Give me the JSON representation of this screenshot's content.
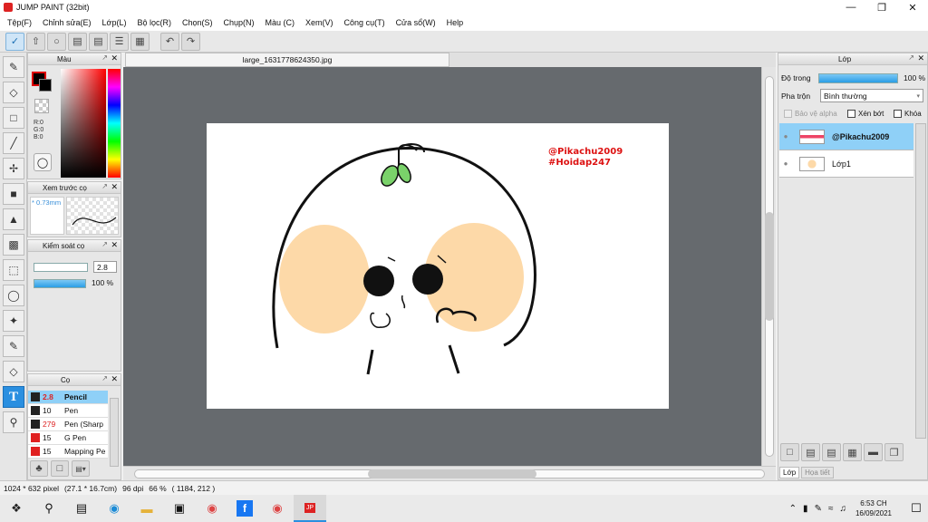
{
  "app": {
    "title": "JUMP PAINT (32bit)"
  },
  "menu": [
    "Tệp(F)",
    "Chỉnh sửa(E)",
    "Lớp(L)",
    "Bộ lọc(R)",
    "Chọn(S)",
    "Chụp(N)",
    "Màu (C)",
    "Xem(V)",
    "Công cụ(T)",
    "Cửa sổ(W)",
    "Help"
  ],
  "color_panel": {
    "title": "Màu",
    "r": "R:0",
    "g": "G:0",
    "b": "B:0"
  },
  "brush_preview": {
    "title": "Xem trước cọ",
    "size": "* 0.73mm"
  },
  "brush_control": {
    "title": "Kiểm soát cọ",
    "size_value": "2.8",
    "opacity_value": "100 %"
  },
  "brush_list": {
    "title": "Cọ",
    "items": [
      {
        "size": "2.8",
        "name": "Pencil",
        "color": "#222222",
        "size_color": "#dd2222",
        "selected": true
      },
      {
        "size": "10",
        "name": "Pen",
        "color": "#222222",
        "size_color": "#111111",
        "selected": false
      },
      {
        "size": "279",
        "name": "Pen (Sharp",
        "color": "#222222",
        "size_color": "#dd2222",
        "selected": false
      },
      {
        "size": "15",
        "name": "G Pen",
        "color": "#e02020",
        "size_color": "#111111",
        "selected": false
      },
      {
        "size": "15",
        "name": "Mapping Pe",
        "color": "#e02020",
        "size_color": "#111111",
        "selected": false
      }
    ]
  },
  "document": {
    "tab": "large_1631778624350.jpg"
  },
  "artwork": {
    "watermark1": "@Pikachu2009",
    "watermark2": "#Hoidap247"
  },
  "layer_panel": {
    "title": "Lớp",
    "opacity_label": "Độ trong",
    "opacity_value": "100 %",
    "blend_label": "Pha trộn",
    "blend_value": "Bình thường",
    "protect_alpha": "Bảo vệ alpha",
    "clip": "Xén bớt",
    "lock": "Khóa",
    "layers": [
      {
        "name": "@Pikachu2009",
        "selected": true
      },
      {
        "name": "Lớp1",
        "selected": false
      }
    ],
    "bottom_tabs": [
      "Lớp",
      "Họa tiết"
    ]
  },
  "status": {
    "size": "1024 * 632 pixel",
    "cm": "(27.1 * 16.7cm)",
    "dpi": "96 dpi",
    "zoom": "66 %",
    "coords": "( 1184, 212 )"
  },
  "taskbar": {
    "time": "6:53 CH",
    "date": "16/09/2021"
  }
}
